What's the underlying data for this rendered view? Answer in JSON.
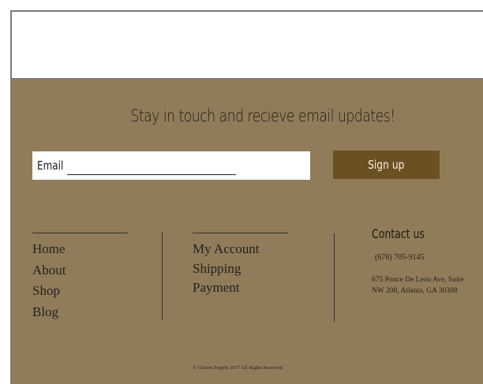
{
  "newsletter": {
    "heading": "Stay in touch and recieve email updates!",
    "email_label": "Email",
    "email_value": "",
    "signup_label": "Sign up"
  },
  "nav_primary": [
    "Home",
    "About",
    "Shop",
    "Blog"
  ],
  "nav_account": [
    "My Account",
    "Shipping",
    "Payment"
  ],
  "contact": {
    "title": "Contact us",
    "phone": "(678) 705-9145",
    "address_line1": "675 Ponce De Leon Ave, Suite",
    "address_line2": "NW 208, Atlanta, GA 30308"
  },
  "copyright": "© Citizen Supply 2017 All Rights Reserved",
  "colors": {
    "footer_bg": "#917c59",
    "button_bg": "#6b5122",
    "text_dark": "#1f1a14"
  }
}
